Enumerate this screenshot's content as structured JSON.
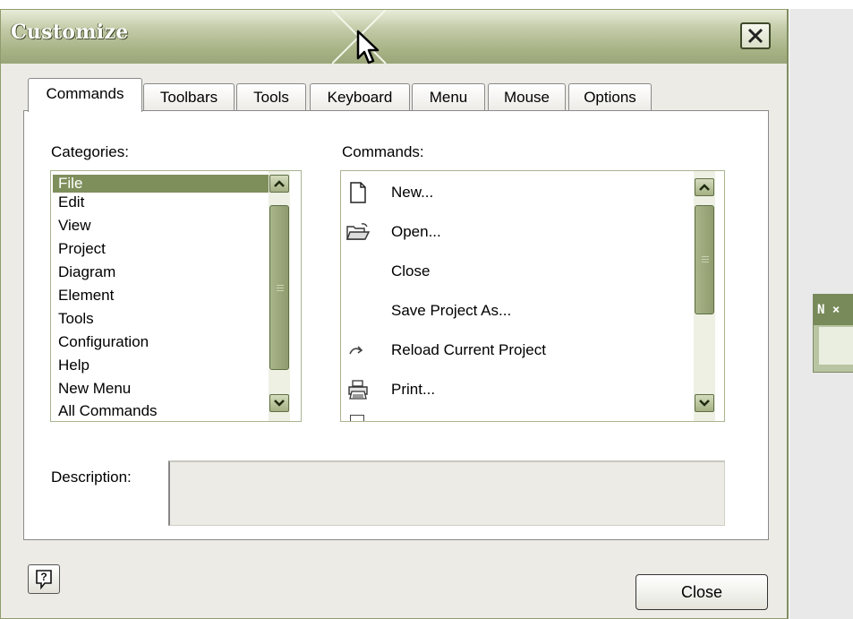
{
  "dialog": {
    "title": "Customize"
  },
  "tabs": [
    {
      "label": "Commands",
      "active": true
    },
    {
      "label": "Toolbars",
      "active": false
    },
    {
      "label": "Tools",
      "active": false
    },
    {
      "label": "Keyboard",
      "active": false
    },
    {
      "label": "Menu",
      "active": false
    },
    {
      "label": "Mouse",
      "active": false
    },
    {
      "label": "Options",
      "active": false
    }
  ],
  "categories": {
    "label": "Categories:",
    "selected": "File",
    "items": [
      "File",
      "Edit",
      "View",
      "Project",
      "Diagram",
      "Element",
      "Tools",
      "Configuration",
      "Help",
      "New Menu",
      "All Commands"
    ]
  },
  "commands": {
    "label": "Commands:",
    "items": [
      {
        "label": "New...",
        "icon": "new-document-icon"
      },
      {
        "label": "Open...",
        "icon": "open-folder-icon"
      },
      {
        "label": "Close",
        "icon": ""
      },
      {
        "label": "Save Project As...",
        "icon": ""
      },
      {
        "label": "Reload Current Project",
        "icon": "reload-icon"
      },
      {
        "label": "Print...",
        "icon": "printer-icon"
      }
    ]
  },
  "description": {
    "label": "Description:",
    "value": ""
  },
  "buttons": {
    "help_icon": "help-icon",
    "close_label": "Close"
  },
  "side_panel": {
    "header_text": "N ×"
  },
  "colors": {
    "title_bar": "#a7b285",
    "selection": "#7f8f5c",
    "scrollbar": "#8f9c6e"
  }
}
